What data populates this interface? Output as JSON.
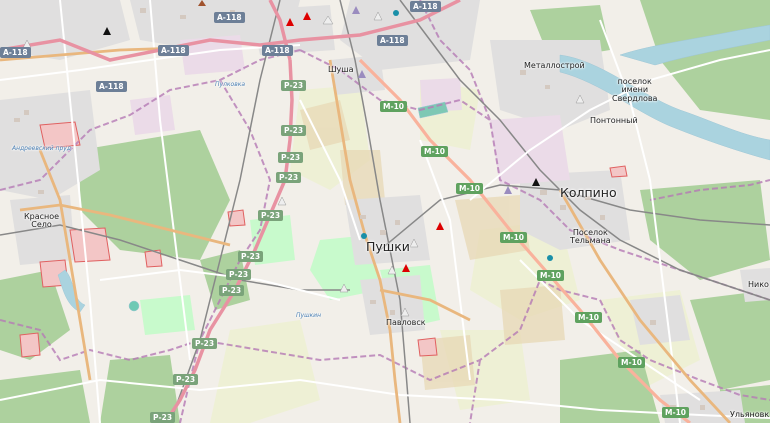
{
  "places": [
    {
      "id": "shushary",
      "name": "Шуша",
      "size": "small"
    },
    {
      "id": "metallostroy",
      "name": "Металлострой",
      "size": "small"
    },
    {
      "id": "sverdlova",
      "name": "поселок\nимени\nСвердлова",
      "size": "small"
    },
    {
      "id": "pontonny",
      "name": "Понтонный",
      "size": "small"
    },
    {
      "id": "kolpino",
      "name": "Колпино",
      "size": "big"
    },
    {
      "id": "telmana",
      "name": "Поселок\nТельмана",
      "size": "small"
    },
    {
      "id": "krasnoe",
      "name": "Красное\nСело",
      "size": "small"
    },
    {
      "id": "pushkin",
      "name": "Пушки",
      "size": "big"
    },
    {
      "id": "pavlovsk",
      "name": "Павловск",
      "size": "small"
    },
    {
      "id": "niko",
      "name": "Нико",
      "size": "small"
    },
    {
      "id": "ulyanovka",
      "name": "Ульяновк",
      "size": "small"
    }
  ],
  "water_labels": [
    {
      "id": "pulkovka",
      "name": "Пулковка"
    },
    {
      "id": "pond",
      "name": "Андреевский пруд"
    },
    {
      "id": "slavyanka",
      "name": "Пушкин"
    }
  ],
  "road_shields": [
    {
      "id": "a118-1",
      "ref": "А-118",
      "kind": "a"
    },
    {
      "id": "a118-2",
      "ref": "А-118",
      "kind": "a"
    },
    {
      "id": "a118-3",
      "ref": "А-118",
      "kind": "a"
    },
    {
      "id": "a118-4",
      "ref": "А-118",
      "kind": "a"
    },
    {
      "id": "a118-5",
      "ref": "А-118",
      "kind": "a"
    },
    {
      "id": "a118-6",
      "ref": "А-118",
      "kind": "a"
    },
    {
      "id": "a118-7",
      "ref": "А-118",
      "kind": "a"
    },
    {
      "id": "p23-1",
      "ref": "Р-23",
      "kind": "p"
    },
    {
      "id": "p23-2",
      "ref": "Р-23",
      "kind": "p"
    },
    {
      "id": "p23-3",
      "ref": "Р-23",
      "kind": "p"
    },
    {
      "id": "p23-4",
      "ref": "Р-23",
      "kind": "p"
    },
    {
      "id": "p23-5",
      "ref": "Р-23",
      "kind": "p"
    },
    {
      "id": "p23-6",
      "ref": "Р-23",
      "kind": "p"
    },
    {
      "id": "p23-7",
      "ref": "Р-23",
      "kind": "p"
    },
    {
      "id": "p23-8",
      "ref": "Р-23",
      "kind": "p"
    },
    {
      "id": "p23-9",
      "ref": "Р-23",
      "kind": "p"
    },
    {
      "id": "p23-10",
      "ref": "Р-23",
      "kind": "p"
    },
    {
      "id": "p23-11",
      "ref": "Р-23",
      "kind": "p"
    },
    {
      "id": "m10-1",
      "ref": "М-10",
      "kind": "m"
    },
    {
      "id": "m10-2",
      "ref": "М-10",
      "kind": "m"
    },
    {
      "id": "m10-3",
      "ref": "М-10",
      "kind": "m"
    },
    {
      "id": "m10-4",
      "ref": "М-10",
      "kind": "m"
    },
    {
      "id": "m10-5",
      "ref": "М-10",
      "kind": "m"
    },
    {
      "id": "m10-6",
      "ref": "М-10",
      "kind": "m"
    },
    {
      "id": "m10-7",
      "ref": "М-10",
      "kind": "m"
    },
    {
      "id": "m10-8",
      "ref": "М-10",
      "kind": "m"
    }
  ],
  "colors": {
    "background": "#f2efe9",
    "forest": "#add19e",
    "park": "#c8facc",
    "farmland": "#eef0d5",
    "residential": "#e0dfdf",
    "industrial": "#ebdbe8",
    "water": "#aad3df",
    "boundary": "#b57ab5",
    "motorway": "#e892a2",
    "trunk": "#f9b29c",
    "primary": "#fcd6a4",
    "rail": "#777777",
    "shield_a": "#6d7f97",
    "shield_m": "#5fa25f"
  }
}
